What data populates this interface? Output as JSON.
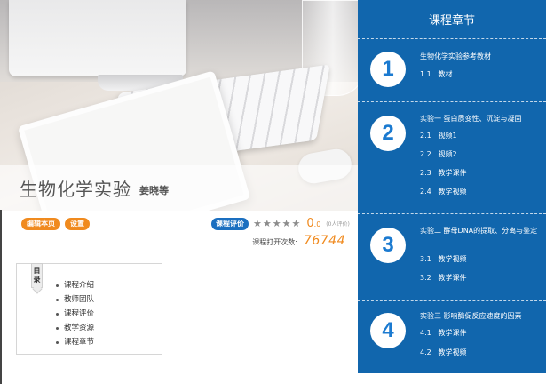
{
  "course": {
    "title": "生物化学实验",
    "author": "姜晓等"
  },
  "actions": {
    "edit_label": "编辑本页",
    "settings_label": "设置"
  },
  "rating": {
    "badge_label": "课程评价",
    "stars": 5,
    "stars_filled": 0,
    "score_int": "0",
    "score_dec": ".0",
    "count_text": "(0人评价)"
  },
  "views": {
    "label": "课程打开次数:",
    "count": "76744"
  },
  "toc": {
    "badge_chars": [
      "目",
      "录"
    ],
    "items": [
      "课程介绍",
      "教师团队",
      "课程评价",
      "教学资源",
      "课程章节"
    ]
  },
  "chapters_panel": {
    "header": "课程章节",
    "chapters": [
      {
        "num": "1",
        "title": "生物化学实验参考教材",
        "items": [
          {
            "n": "1.1",
            "label": "教材"
          }
        ]
      },
      {
        "num": "2",
        "title": "实验一 蛋白质变性、沉淀与凝固",
        "items": [
          {
            "n": "2.1",
            "label": "视频1"
          },
          {
            "n": "2.2",
            "label": "视频2"
          },
          {
            "n": "2.3",
            "label": "教学课件"
          },
          {
            "n": "2.4",
            "label": "教学视频"
          }
        ]
      },
      {
        "num": "3",
        "title": "实验二 酵母DNA的提取、分离与鉴定",
        "items": [
          {
            "n": "3.1",
            "label": "教学视频"
          },
          {
            "n": "3.2",
            "label": "教学课件"
          }
        ]
      },
      {
        "num": "4",
        "title": "实验三 影响酶促反应速度的因素",
        "items": [
          {
            "n": "4.1",
            "label": "教学课件"
          },
          {
            "n": "4.2",
            "label": "教学视频"
          }
        ]
      }
    ]
  },
  "colors": {
    "panel_blue": "#1166ad",
    "accent_orange": "#f08a1e",
    "badge_blue": "#1b6fc0"
  }
}
